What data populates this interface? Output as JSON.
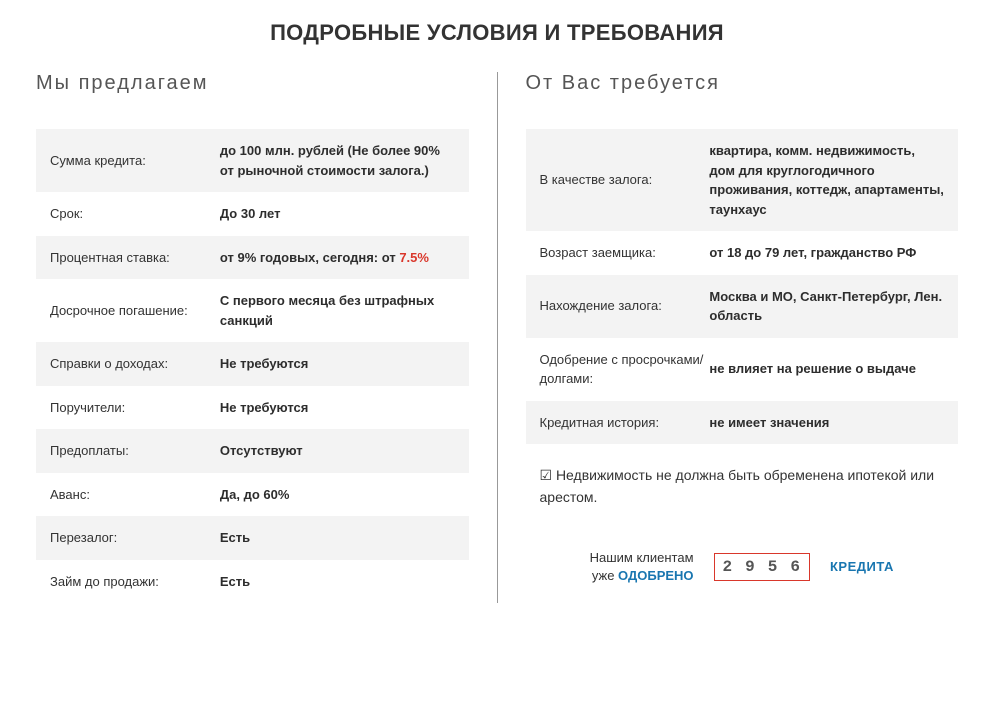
{
  "title": "ПОДРОБНЫЕ УСЛОВИЯ И ТРЕБОВАНИЯ",
  "left": {
    "heading": "Мы предлагаем",
    "rows": [
      {
        "label": "Сумма кредита:",
        "value": "до 100 млн. рублей (Не более 90% от рыночной стоимости залога.)"
      },
      {
        "label": "Срок:",
        "value": "До 30 лет"
      },
      {
        "label": "Процентная ставка:",
        "value_prefix": "от 9% годовых, сегодня: от ",
        "value_accent": "7.5%"
      },
      {
        "label": "Досрочное погашение:",
        "value": "С первого месяца без штрафных санкций"
      },
      {
        "label": "Справки о доходах:",
        "value": "Не требуются"
      },
      {
        "label": "Поручители:",
        "value": "Не требуются"
      },
      {
        "label": "Предоплаты:",
        "value": "Отсутствуют"
      },
      {
        "label": "Аванс:",
        "value": "Да, до 60%"
      },
      {
        "label": "Перезалог:",
        "value": "Есть"
      },
      {
        "label": "Займ до продажи:",
        "value": "Есть"
      }
    ]
  },
  "right": {
    "heading": "От Вас требуется",
    "rows": [
      {
        "label": "В качестве залога:",
        "value": "квартира, комм. недвижимость, дом для круглогодичного проживания, коттедж, апартаменты, таунхаус"
      },
      {
        "label": "Возраст заемщика:",
        "value": "от 18 до 79 лет, гражданство РФ"
      },
      {
        "label": "Нахождение залога:",
        "value": "Москва и МО, Санкт-Петербург, Лен. область"
      },
      {
        "label": "Одобрение с просрочками/долгами:",
        "value": "не влияет на решение о выдаче"
      },
      {
        "label": "Кредитная история:",
        "value": "не имеет значения"
      }
    ],
    "note": "☑ Недвижимость не должна быть обременена ипотекой или арестом."
  },
  "approved": {
    "line1": "Нашим клиентам",
    "line2_prefix": "уже ",
    "line2_accent": "ОДОБРЕНО",
    "counter": [
      "2",
      "9",
      "5",
      "6"
    ],
    "suffix": "КРЕДИТА"
  }
}
